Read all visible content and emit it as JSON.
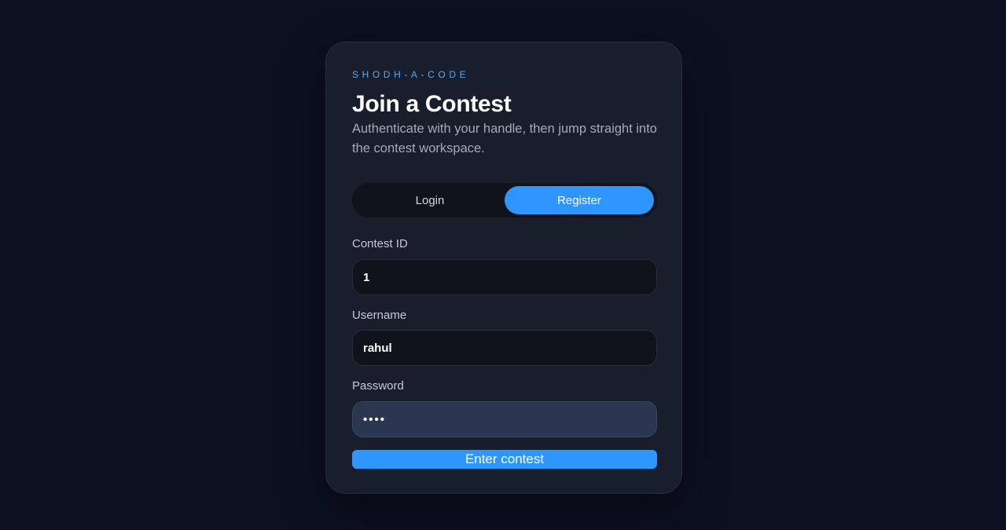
{
  "brand": {
    "eyebrow": "SHODH-A-CODE"
  },
  "heading": {
    "title": "Join a Contest",
    "subtitle": "Authenticate with your handle, then jump straight into the contest workspace."
  },
  "auth_toggle": {
    "login_label": "Login",
    "register_label": "Register",
    "active": "Register"
  },
  "form": {
    "contest_id": {
      "label": "Contest ID",
      "value": "1"
    },
    "username": {
      "label": "Username",
      "value": "rahul"
    },
    "password": {
      "label": "Password",
      "masked_value": "••••"
    },
    "submit_label": "Enter contest"
  },
  "colors": {
    "background": "#0b1120",
    "card": "#181e2b",
    "accent": "#2f95ff",
    "eyebrow": "#5aa9f0"
  }
}
